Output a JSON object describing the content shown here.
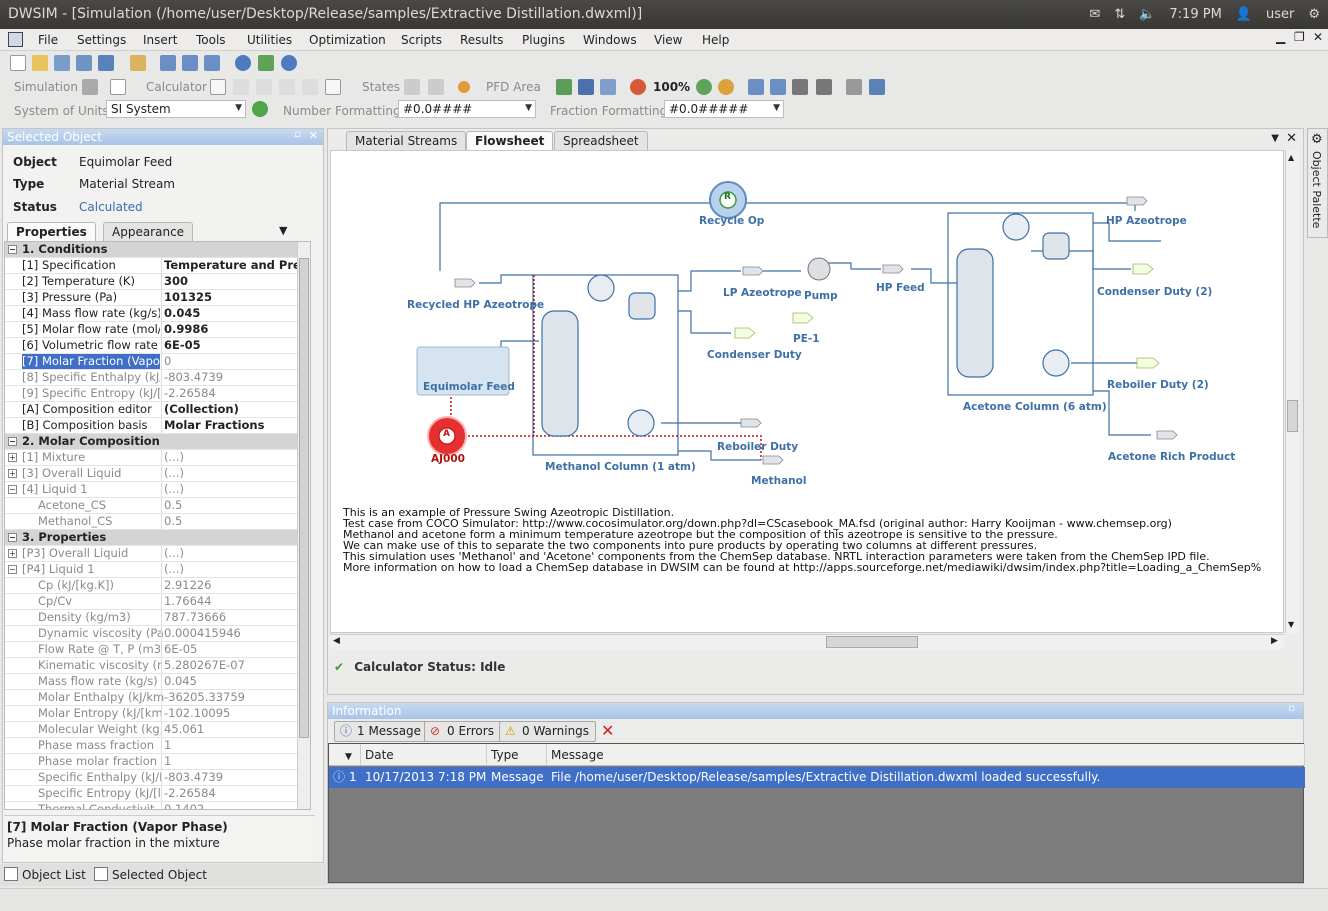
{
  "window": {
    "title": "DWSIM - [Simulation (/home/user/Desktop/Release/samples/Extractive Distillation.dwxml)]"
  },
  "tray": {
    "time": "7:19 PM",
    "user": "user"
  },
  "menu": [
    "File",
    "Settings",
    "Insert",
    "Tools",
    "Utilities",
    "Optimization",
    "Scripts",
    "Results",
    "Plugins",
    "Windows",
    "View",
    "Help"
  ],
  "toolbar": {
    "simulation_label": "Simulation",
    "calculator_label": "Calculator",
    "states_label": "States",
    "pfd_label": "PFD Area",
    "zoom": "100%",
    "units_label": "System of Units",
    "units_value": "SI System",
    "numfmt_label": "Number Formatting",
    "numfmt_value": "#0.0####",
    "fracfmt_label": "Fraction Formatting",
    "fracfmt_value": "#0.0#####"
  },
  "selected": {
    "panel_title": "Selected Object",
    "object_label": "Object",
    "object_value": "Equimolar Feed",
    "type_label": "Type",
    "type_value": "Material Stream",
    "status_label": "Status",
    "status_value": "Calculated",
    "tabs": [
      "Properties",
      "Appearance"
    ]
  },
  "grid": {
    "rows": [
      {
        "k": "1. Conditions",
        "v": "",
        "cat": true,
        "pm": "-"
      },
      {
        "k": "[1] Specification",
        "v": "Temperature and Pre",
        "bold": true
      },
      {
        "k": "[2] Temperature (K)",
        "v": "300",
        "bold": true
      },
      {
        "k": "[3] Pressure (Pa)",
        "v": "101325",
        "bold": true
      },
      {
        "k": "[4] Mass flow rate (kg/s)",
        "v": "0.045",
        "bold": true
      },
      {
        "k": "[5] Molar flow rate (mol/",
        "v": "0.9986",
        "bold": true
      },
      {
        "k": "[6] Volumetric flow rate",
        "v": "6E-05",
        "bold": true
      },
      {
        "k": "[7] Molar Fraction (Vapo",
        "v": "0",
        "sel": true,
        "dim": true
      },
      {
        "k": "[8] Specific Enthalpy (kJ/",
        "v": "-803.4739",
        "dim": true
      },
      {
        "k": "[9] Specific Entropy (kJ/[",
        "v": "-2.26584",
        "dim": true
      },
      {
        "k": "[A] Composition editor",
        "v": "(Collection)",
        "bold": true
      },
      {
        "k": "[B] Composition basis",
        "v": "Molar Fractions",
        "bold": true
      },
      {
        "k": "2. Molar Composition",
        "v": "",
        "cat": true,
        "pm": "-"
      },
      {
        "k": "[1] Mixture",
        "v": "(...)",
        "dim": true,
        "pm": "+"
      },
      {
        "k": "[3] Overall Liquid",
        "v": "(...)",
        "dim": true,
        "pm": "+"
      },
      {
        "k": "[4] Liquid 1",
        "v": "(...)",
        "dim": true,
        "pm": "-"
      },
      {
        "k": "Acetone_CS",
        "v": "0.5",
        "dim": true,
        "ind": true
      },
      {
        "k": "Methanol_CS",
        "v": "0.5",
        "dim": true,
        "ind": true
      },
      {
        "k": "3. Properties",
        "v": "",
        "cat": true,
        "pm": "-"
      },
      {
        "k": "[P3] Overall Liquid",
        "v": "(...)",
        "dim": true,
        "pm": "+"
      },
      {
        "k": "[P4] Liquid 1",
        "v": "(...)",
        "dim": true,
        "pm": "-"
      },
      {
        "k": "Cp (kJ/[kg.K])",
        "v": "2.91226",
        "dim": true,
        "ind": true
      },
      {
        "k": "Cp/Cv",
        "v": "1.76644",
        "dim": true,
        "ind": true
      },
      {
        "k": "Density (kg/m3)",
        "v": "787.73666",
        "dim": true,
        "ind": true
      },
      {
        "k": "Dynamic viscosity (Pa",
        "v": "0.000415946",
        "dim": true,
        "ind": true
      },
      {
        "k": "Flow Rate @ T, P (m3",
        "v": "6E-05",
        "dim": true,
        "ind": true
      },
      {
        "k": "Kinematic viscosity (r",
        "v": "5.280267E-07",
        "dim": true,
        "ind": true
      },
      {
        "k": "Mass flow rate (kg/s)",
        "v": "0.045",
        "dim": true,
        "ind": true
      },
      {
        "k": "Molar Enthalpy (kJ/km",
        "v": "-36205.33759",
        "dim": true,
        "ind": true
      },
      {
        "k": "Molar Entropy (kJ/[km",
        "v": "-102.10095",
        "dim": true,
        "ind": true
      },
      {
        "k": "Molecular Weight (kg,",
        "v": "45.061",
        "dim": true,
        "ind": true
      },
      {
        "k": "Phase mass fraction",
        "v": "1",
        "dim": true,
        "ind": true
      },
      {
        "k": "Phase molar fraction",
        "v": "1",
        "dim": true,
        "ind": true
      },
      {
        "k": "Specific Enthalpy (kJ/I",
        "v": "-803.4739",
        "dim": true,
        "ind": true
      },
      {
        "k": "Specific Entropy (kJ/[l",
        "v": "-2.26584",
        "dim": true,
        "ind": true
      },
      {
        "k": "Thermal Conductivit",
        "v": "0.1402",
        "dim": true,
        "ind": true
      }
    ]
  },
  "description": {
    "title": "[7] Molar Fraction (Vapor Phase)",
    "text": "Phase molar fraction in the mixture"
  },
  "bottom_tabs": [
    "Object List",
    "Selected Object"
  ],
  "doc_tabs": [
    "Material Streams",
    "Flowsheet",
    "Spreadsheet"
  ],
  "palette_label": "Object Palette",
  "flowsheet": {
    "labels": {
      "recycle_op": "Recycle Op",
      "recycled_hp": "Recycled HP Azeotrope",
      "equimolar_feed": "Equimolar Feed",
      "aj000": "AJ000",
      "lp_azeotrope": "LP Azeotrope",
      "condenser_duty": "Condenser Duty",
      "pump": "Pump",
      "pe1": "PE-1",
      "hp_feed": "HP Feed",
      "hp_azeotrope": "HP Azeotrope",
      "condenser_duty2": "Condenser Duty (2)",
      "reboiler_duty2": "Reboiler Duty (2)",
      "acetone_column": "Acetone Column (6 atm)",
      "reboiler_duty": "Reboiler Duty",
      "methanol_column": "Methanol Column (1 atm)",
      "methanol": "Methanol",
      "acetone_rich": "Acetone Rich Product",
      "recycle_glyph": "R",
      "adjust_glyph": "A"
    },
    "notes": [
      "This is an example of Pressure Swing Azeotropic Distillation.",
      "Test case from COCO Simulator: http://www.cocosimulator.org/down.php?dl=CScasebook_MA.fsd (original author: Harry Kooijman - www.chemsep.org)",
      "Methanol and acetone form a minimum temperature azeotrope but the composition of this azeotrope is sensitive to the pressure.",
      "We can make use of this to separate the two components into pure products by operating two columns at different pressures.",
      "This simulation uses 'Methanol' and 'Acetone' components from the ChemSep database. NRTL interaction parameters were taken from the ChemSep IPD file.",
      "More information on how to load a ChemSep database in DWSIM can be found at http://apps.sourceforge.net/mediawiki/dwsim/index.php?title=Loading_a_ChemSep%"
    ]
  },
  "calc_status": "Calculator Status: Idle",
  "info": {
    "panel_title": "Information",
    "btn_messages": "1 Message",
    "btn_errors": "0 Errors",
    "btn_warnings": "0 Warnings",
    "columns": [
      "Date",
      "Type",
      "Message"
    ],
    "row": {
      "index": "1",
      "date": "10/17/2013 7:18 PM",
      "type": "Message",
      "message": "File /home/user/Desktop/Release/samples/Extractive Distillation.dwxml loaded successfully."
    }
  }
}
